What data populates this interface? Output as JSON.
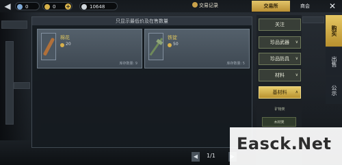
{
  "topbar": {
    "back_label": "◀",
    "resources": [
      {
        "value": "0",
        "color": "#7ea9d6"
      },
      {
        "value": "0",
        "color": "#d6b14a"
      },
      {
        "value": "10648",
        "color": "#cfd6dc"
      }
    ],
    "plus_label": "+",
    "trade_record": "交易记录",
    "tab_exchange": "交易所",
    "tab_mall": "商会",
    "close_label": "✕"
  },
  "panel": {
    "header": "只显示最低价及在售数量",
    "items": [
      {
        "name": "棉花",
        "price": "20",
        "stock": "库存数量: 9"
      },
      {
        "name": "铁锭",
        "price": "50",
        "stock": "库存数量: 5"
      }
    ]
  },
  "pager": {
    "prev": "◀",
    "text": "1/1",
    "next": "▶"
  },
  "categories": [
    {
      "label": "关注",
      "chev": ""
    },
    {
      "label": "珍品武器",
      "chev": "∨"
    },
    {
      "label": "珍品防具",
      "chev": "∨"
    },
    {
      "label": "材料",
      "chev": "∨"
    },
    {
      "label": "基材料",
      "chev": "∧"
    }
  ],
  "subcat_label": "矿物类",
  "subcat_item": "木材类",
  "side_tabs": {
    "buy": "购买",
    "sell": "出售",
    "pub": "公示"
  },
  "watermark": "Easck.Net",
  "colors": {
    "gold": "#e2c56a",
    "panel": "#161b21"
  }
}
